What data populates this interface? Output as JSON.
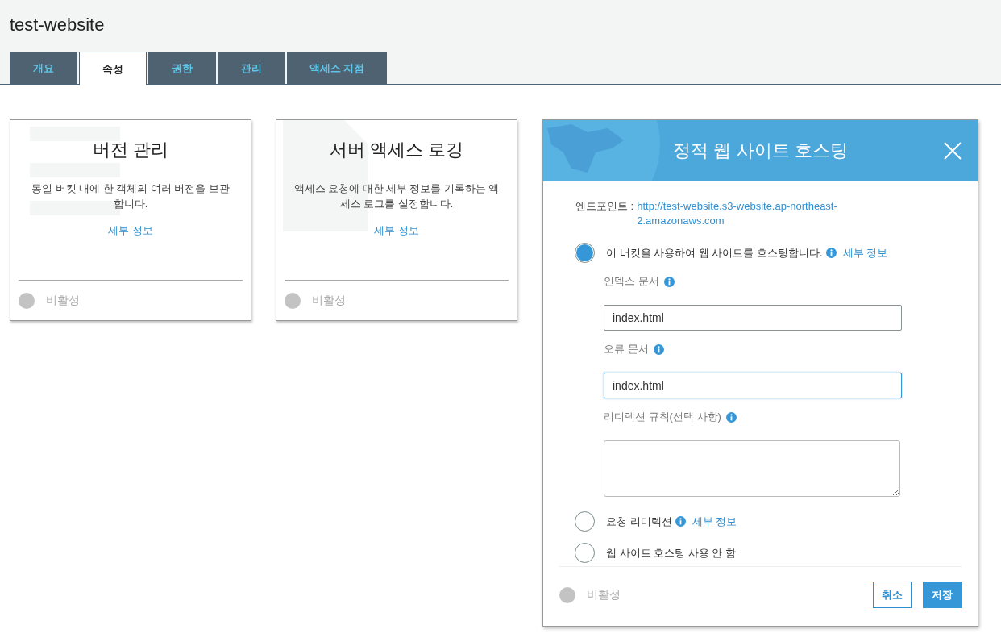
{
  "page_title": "test-website",
  "tabs": [
    {
      "label": "개요",
      "selected": false
    },
    {
      "label": "속성",
      "selected": true
    },
    {
      "label": "권한",
      "selected": false
    },
    {
      "label": "관리",
      "selected": false
    },
    {
      "label": "액세스 지점",
      "selected": false
    }
  ],
  "cards": [
    {
      "title": "버전 관리",
      "description": "동일 버킷 내에 한 객체의 여러 버전을 보관합니다.",
      "link": "세부 정보",
      "status": {
        "label": "비활성",
        "enabled": false
      }
    },
    {
      "title": "서버 액세스 로깅",
      "description": "액세스 요청에 대한 세부 정보를 기록하는 액세스 로그를 설정합니다.",
      "link": "세부 정보",
      "status": {
        "label": "비활성",
        "enabled": false
      }
    }
  ],
  "panel": {
    "title": "정적 웹 사이트 호스팅",
    "endpoint": {
      "label": "엔드포인트 :",
      "url": "http://test-website.s3-website.ap-northeast-2.amazonaws.com"
    },
    "options": [
      {
        "label": "이 버킷을 사용하여 웹 사이트를 호스팅합니다.",
        "selected": true,
        "info": true,
        "link": "세부 정보",
        "fields": [
          {
            "kind": "input",
            "label": "인덱스 문서",
            "value": "index.html",
            "focused": false
          },
          {
            "kind": "input",
            "label": "오류 문서",
            "value": "index.html",
            "focused": true
          },
          {
            "kind": "textarea",
            "label": "리디렉션 규칙(선택 사항)",
            "focused": false
          }
        ]
      },
      {
        "label": "요청 리디렉션",
        "selected": false,
        "info": true,
        "link": "세부 정보"
      },
      {
        "label": "웹 사이트 호스팅 사용 안 함",
        "selected": false,
        "info": false
      }
    ],
    "status": {
      "label": "비활성",
      "enabled": false
    },
    "buttons": [
      {
        "kind": "secondary",
        "label": "취소"
      },
      {
        "kind": "primary",
        "label": "저장"
      }
    ]
  }
}
